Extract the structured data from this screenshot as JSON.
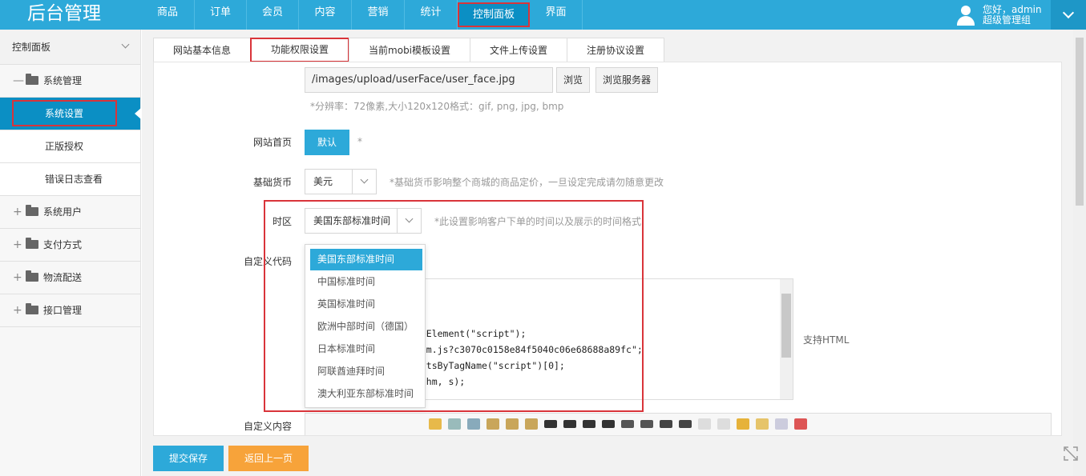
{
  "app": {
    "logo": "后台管理"
  },
  "nav": {
    "items": [
      "商品",
      "订单",
      "会员",
      "内容",
      "营销",
      "统计",
      "控制面板",
      "界面"
    ],
    "active_index": 6
  },
  "user": {
    "greeting": "您好，admin",
    "role": "超级管理组"
  },
  "sidebar": {
    "header": "控制面板",
    "groups": [
      {
        "toggle": "—",
        "label": "系统管理",
        "children": [
          "系统设置",
          "正版授权",
          "错误日志查看"
        ],
        "active_child": 0
      },
      {
        "toggle": "+",
        "label": "系统用户"
      },
      {
        "toggle": "+",
        "label": "支付方式"
      },
      {
        "toggle": "+",
        "label": "物流配送"
      },
      {
        "toggle": "+",
        "label": "接口管理"
      }
    ]
  },
  "tabs": {
    "items": [
      "网站基本信息",
      "功能权限设置",
      "当前mobi模板设置",
      "文件上传设置",
      "注册协议设置"
    ],
    "active_index": 1
  },
  "form": {
    "avatar_path": "/images/upload/userFace/user_face.jpg",
    "browse_label": "浏览",
    "browse_server_label": "浏览服务器",
    "avatar_hint": "*分辨率：72像素,大小120x120格式：gif, png, jpg, bmp",
    "homepage_label": "网站首页",
    "homepage_button": "默认",
    "homepage_asterisk": "*",
    "currency_label": "基础货币",
    "currency_value": "美元",
    "currency_hint": "*基础货币影响整个商城的商品定价，一旦设定完成请勿随意更改",
    "timezone_label": "时区",
    "timezone_value": "美国东部标准时间",
    "timezone_hint": "*此设置影响客户下单的时间以及展示的时间格式",
    "custom_code_label": "自定义代码",
    "custom_code_lines": [
      "ateElement(\"script\");",
      "m/hm.js?c3070c0158e84f5040c06e68688a89fc\";",
      "mentsByTagName(\"script\")[0];",
      "re(hm, s);"
    ],
    "custom_code_hint": "支持HTML",
    "custom_content_label": "自定义内容"
  },
  "timezone_dropdown": {
    "options": [
      "美国东部标准时间",
      "中国标准时间",
      "英国标准时间",
      "欧洲中部时间（德国）",
      "日本标准时间",
      "阿联酋迪拜时间",
      "澳大利亚东部标准时间"
    ],
    "selected_index": 0
  },
  "footer": {
    "submit": "提交保存",
    "back": "返回上一页"
  },
  "colors": {
    "accent": "#2da9d9",
    "highlight": "#d9343a",
    "back_button": "#f7a33a"
  }
}
